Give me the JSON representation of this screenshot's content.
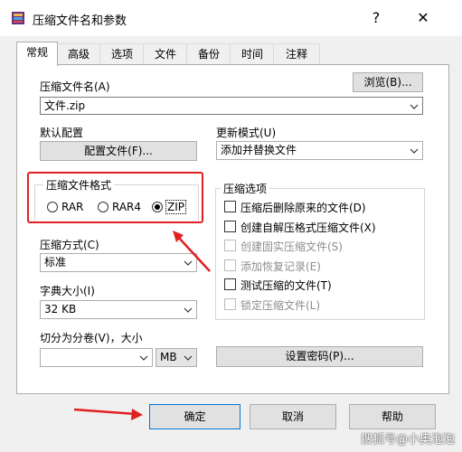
{
  "window": {
    "title": "压缩文件名和参数",
    "help_glyph": "?",
    "close_glyph": "✕"
  },
  "tabs": [
    "常规",
    "高级",
    "选项",
    "文件",
    "备份",
    "时间",
    "注释"
  ],
  "archive_name": {
    "label": "压缩文件名(A)",
    "value": "文件.zip",
    "browse_label": "浏览(B)..."
  },
  "default_profile": {
    "label": "默认配置",
    "button_label": "配置文件(F)..."
  },
  "update_mode": {
    "label": "更新模式(U)",
    "value": "添加并替换文件"
  },
  "archive_format": {
    "label": "压缩文件格式",
    "options": [
      "RAR",
      "RAR4",
      "ZIP"
    ],
    "selected": "ZIP"
  },
  "compression_method": {
    "label": "压缩方式(C)",
    "value": "标准"
  },
  "dictionary_size": {
    "label": "字典大小(I)",
    "value": "32 KB"
  },
  "split_volumes": {
    "label": "切分为分卷(V)，大小",
    "value": "",
    "unit": "MB"
  },
  "archive_options": {
    "label": "压缩选项",
    "items": [
      {
        "label": "压缩后删除原来的文件(D)",
        "checked": false,
        "enabled": true
      },
      {
        "label": "创建自解压格式压缩文件(X)",
        "checked": false,
        "enabled": true
      },
      {
        "label": "创建固实压缩文件(S)",
        "checked": false,
        "enabled": false
      },
      {
        "label": "添加恢复记录(E)",
        "checked": false,
        "enabled": false
      },
      {
        "label": "测试压缩的文件(T)",
        "checked": false,
        "enabled": true
      },
      {
        "label": "锁定压缩文件(L)",
        "checked": false,
        "enabled": false
      }
    ]
  },
  "set_password": {
    "label": "设置密码(P)..."
  },
  "footer": {
    "ok_label": "确定",
    "cancel_label": "取消",
    "help_label": "帮助"
  },
  "watermark": {
    "text": "搜狐号@小奥泡泡"
  },
  "colors": {
    "annotation_red": "#e02020",
    "focus_blue": "#0078d7"
  }
}
